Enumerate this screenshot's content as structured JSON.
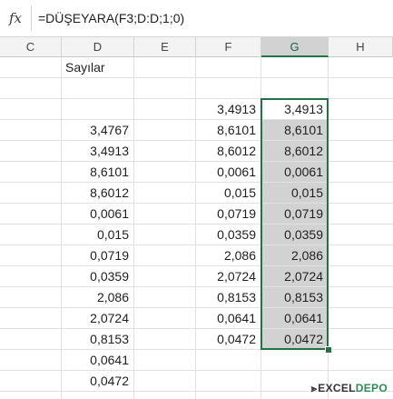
{
  "formula_bar": {
    "fx_label": "fx",
    "formula": "=DÜŞEYARA(F3;D:D;1;0)"
  },
  "columns": [
    "C",
    "D",
    "E",
    "F",
    "G",
    "H"
  ],
  "selected_column": "G",
  "header_cell": "Sayılar",
  "column_d": [
    "3,4767",
    "3,4913",
    "8,6101",
    "8,6012",
    "0,0061",
    "0,015",
    "0,0719",
    "0,0359",
    "2,086",
    "2,0724",
    "0,8153",
    "0,0641",
    "0,0472"
  ],
  "column_f": [
    "3,4913",
    "8,6101",
    "8,6012",
    "0,0061",
    "0,015",
    "0,0719",
    "0,0359",
    "2,086",
    "2,0724",
    "0,8153",
    "0,0641",
    "0,0472"
  ],
  "column_g": [
    "3,4913",
    "8,6101",
    "8,6012",
    "0,0061",
    "0,015",
    "0,0719",
    "0,0359",
    "2,086",
    "2,0724",
    "0,8153",
    "0,0641",
    "0,0472"
  ],
  "watermark": {
    "part1": "EXCEL",
    "part2": "DEPO"
  },
  "colors": {
    "accent": "#217346",
    "selection_fill": "#d2d2d2"
  }
}
